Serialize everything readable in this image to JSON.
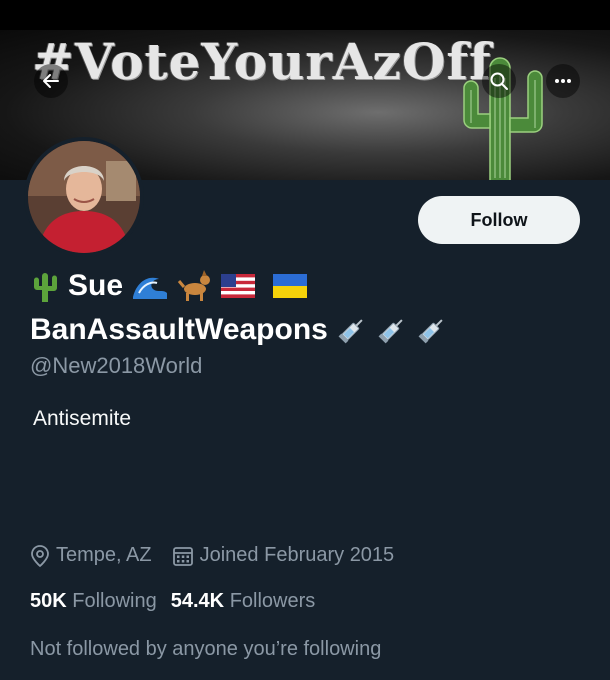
{
  "banner": {
    "hashtag": "#VoteYourAzOff"
  },
  "profile": {
    "name_line1": "Sue",
    "name_line2": "BanAssaultWeapons",
    "handle": "@New2018World",
    "bio": "Antisemite",
    "name_emojis": [
      "cactus-icon",
      "wave-icon",
      "dog-icon",
      "us-flag-icon",
      "ukraine-flag-icon"
    ],
    "name_emojis_line2": [
      "syringe-icon",
      "syringe-icon",
      "syringe-icon"
    ]
  },
  "actions": {
    "follow_label": "Follow"
  },
  "meta": {
    "location": "Tempe, AZ",
    "joined": "Joined February 2015"
  },
  "stats": {
    "following_count": "50K",
    "following_label": "Following",
    "followers_count": "54.4K",
    "followers_label": "Followers"
  },
  "followed_by": "Not followed by anyone you’re following",
  "colors": {
    "background": "#15202b",
    "muted_text": "#8b98a5",
    "follow_button": "#eff3f4"
  }
}
